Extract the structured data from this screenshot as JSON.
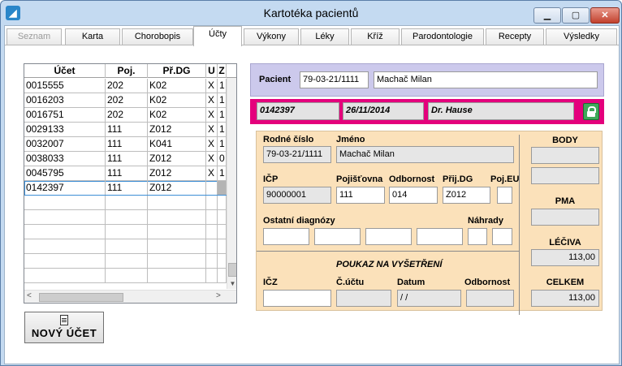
{
  "window": {
    "title": "Kartotéka pacientů",
    "app_icon": "app-logo-icon",
    "controls": {
      "minimize": "▁",
      "maximize": "▢",
      "close": "✕"
    }
  },
  "tabs": [
    {
      "label": "Seznam",
      "state": "disabled"
    },
    {
      "label": "Karta",
      "state": "normal"
    },
    {
      "label": "Chorobopis",
      "state": "normal"
    },
    {
      "label": "Účty",
      "state": "active"
    },
    {
      "label": "Výkony",
      "state": "normal"
    },
    {
      "label": "Léky",
      "state": "normal"
    },
    {
      "label": "Kříž",
      "state": "normal"
    },
    {
      "label": "Parodontologie",
      "state": "normal"
    },
    {
      "label": "Recepty",
      "state": "normal"
    },
    {
      "label": "Výsledky",
      "state": "normal"
    }
  ],
  "grid": {
    "columns": [
      "Účet",
      "Poj.",
      "Př.DG",
      "U",
      "Z"
    ],
    "rows": [
      [
        "0015555",
        "202",
        "K02",
        "X",
        "1"
      ],
      [
        "0016203",
        "202",
        "K02",
        "X",
        "1"
      ],
      [
        "0016751",
        "202",
        "K02",
        "X",
        "1"
      ],
      [
        "0029133",
        "111",
        "Z012",
        "X",
        "1"
      ],
      [
        "0032007",
        "111",
        "K041",
        "X",
        "1"
      ],
      [
        "0038033",
        "111",
        "Z012",
        "X",
        "0"
      ],
      [
        "0045795",
        "111",
        "Z012",
        "X",
        "1"
      ],
      [
        "0142397",
        "111",
        "Z012",
        "",
        ""
      ]
    ],
    "selected_row": 7
  },
  "new_account_button": {
    "label": "NOVÝ ÚČET",
    "icon": "document-icon"
  },
  "patient": {
    "label": "Pacient",
    "birth_number": "79-03-21/1111",
    "name": "Machač Milan"
  },
  "account_bar": {
    "account": "0142397",
    "date": "26/11/2014",
    "doctor": "Dr. Hause",
    "lock_icon": "lock-icon",
    "color": "#e4007c"
  },
  "form": {
    "rodne_cislo": {
      "label": "Rodné číslo",
      "value": "79-03-21/1111"
    },
    "jmeno": {
      "label": "Jméno",
      "value": "Machač Milan"
    },
    "icp": {
      "label": "IČP",
      "value": "90000001"
    },
    "pojistovna": {
      "label": "Pojišťovna",
      "value": "111"
    },
    "odbornost": {
      "label": "Odbornost",
      "value": "014"
    },
    "prij_dg": {
      "label": "Přij.DG",
      "value": "Z012"
    },
    "poj_eu": {
      "label": "Poj.EU",
      "value": ""
    },
    "ostatni": {
      "label": "Ostatní diagnózy"
    },
    "nahrady": {
      "label": "Náhrady"
    },
    "poukaz": {
      "title": "POUKAZ NA VYŠETŘENÍ",
      "icz_label": "IČZ",
      "cucetu_label": "Č.účtu",
      "datum_label": "Datum",
      "datum_value": " / /",
      "odbornost_label": "Odbornost"
    }
  },
  "summary": {
    "body": {
      "label": "BODY"
    },
    "pma": {
      "label": "PMA"
    },
    "leciva": {
      "label": "LÉČIVA",
      "value": "113,00"
    },
    "celkem": {
      "label": "CELKEM",
      "value": "113,00"
    }
  }
}
